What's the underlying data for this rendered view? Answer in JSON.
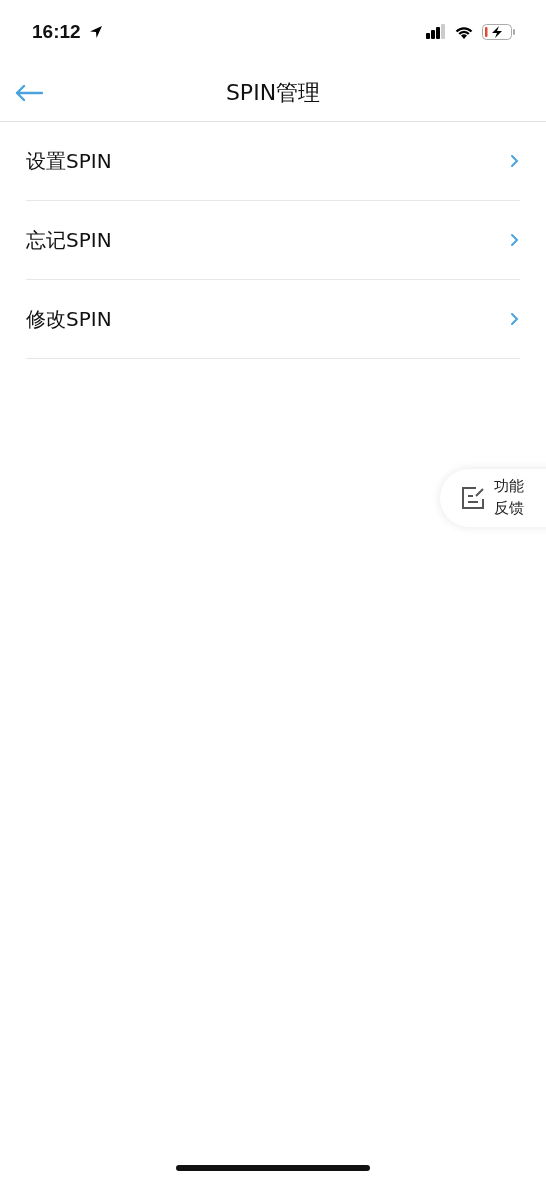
{
  "status_bar": {
    "time": "16:12"
  },
  "nav_bar": {
    "title": "SPIN管理"
  },
  "menu_items": [
    {
      "label": "设置SPIN"
    },
    {
      "label": "忘记SPIN"
    },
    {
      "label": "修改SPIN"
    }
  ],
  "feedback_button": {
    "label": "功能反馈"
  }
}
